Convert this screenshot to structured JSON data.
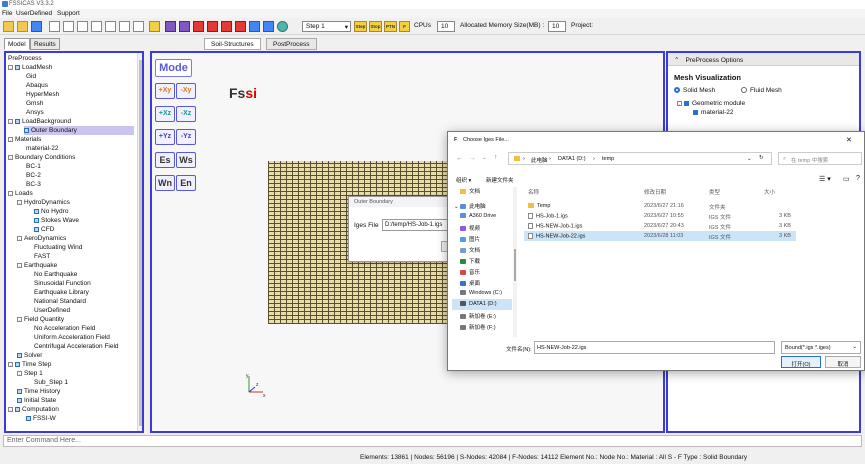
{
  "app": {
    "title": "FSSICAS V3.3.2"
  },
  "menu": [
    "File",
    "UserDefined",
    "Support"
  ],
  "toolbar": {
    "step_value": "Step 1",
    "btn_step": "Step",
    "btn_stop": "Stop",
    "btn_ptn": "PTN",
    "btn_fortran": "F",
    "cpus_label": "CPUs",
    "cpus_value": "10",
    "memory_label": "Allocated Memory Size(MB) :",
    "memory_value": "10",
    "project_label": "Project:"
  },
  "left_tabs": [
    "Model",
    "Results"
  ],
  "tree": [
    "PreProcess",
    "LoadMesh",
    "Gid",
    "Abaqus",
    "HyperMesh",
    "Gmsh",
    "Ansys",
    "LoadBackground",
    "Outer Boundary",
    "Materials",
    "material-22",
    "Boundary Conditions",
    "BC-1",
    "BC-2",
    "BC-3",
    "Loads",
    "HydroDynamics",
    "No Hydro",
    "Stokes Wave",
    "CFD",
    "AeroDynamics",
    "Fluctuating Wind",
    "FAST",
    "Earthquake",
    "No Earthquake",
    "Sinusoidal Function",
    "Earthquake Library",
    "National Standard",
    "UserDefined",
    "Field Quantity",
    "No Acceleration Field",
    "Uniform Acceleration Field",
    "Centrifugal Acceleration Field",
    "Solver",
    "Time Step",
    "Step 1",
    "Sub_Step 1",
    "Time History",
    "Initial State",
    "Computation",
    "FSSI-W"
  ],
  "view_tabs": [
    "Soil-Structures",
    "PostProcess"
  ],
  "view_buttons": [
    "Mode",
    "+Xy",
    "-Xy",
    "+Xz",
    "-Xz",
    "+Yz",
    "-Yz",
    "Es",
    "Ws",
    "Wn",
    "En"
  ],
  "logo": {
    "main": "Fs",
    "sub": "si"
  },
  "axes": {
    "x": "x",
    "y": "y",
    "z": "z"
  },
  "outer_dialog": {
    "title": "Outer Boundary",
    "iges_label": "Iges File",
    "iges_value": "D:/temp/HS-Job-1.igs"
  },
  "preprocess_options": {
    "title": "PreProcess Options",
    "section": "Mesh Visualization",
    "solid": "Solid Mesh",
    "fluid": "Fluid Mesh",
    "geom": "Geometric module",
    "material": "material-22"
  },
  "file_dialog": {
    "title": "Choose Iges File...",
    "path": [
      "此电脑",
      "DATA1 (D:)",
      "temp"
    ],
    "search_placeholder": "在 temp 中搜索",
    "organize": "组织 ▾",
    "new_folder": "新建文件夹",
    "columns": [
      "名称",
      "修改日期",
      "类型",
      "大小"
    ],
    "files": [
      {
        "name": "Temp",
        "date": "2023/6/27 21:16",
        "type": "文件夹",
        "size": ""
      },
      {
        "name": "HS-Job-1.igs",
        "date": "2023/6/27 10:55",
        "type": "IGS 文件",
        "size": "3 KB"
      },
      {
        "name": "HS-NEW-Job-1.igs",
        "date": "2023/6/27 20:43",
        "type": "IGS 文件",
        "size": "3 KB"
      },
      {
        "name": "HS-NEW-Job-22.igs",
        "date": "2023/6/28 11:03",
        "type": "IGS 文件",
        "size": "3 KB"
      }
    ],
    "sidebar": [
      "文档",
      "此电脑",
      "A360 Drive",
      "视频",
      "图片",
      "文档",
      "下载",
      "音乐",
      "桌面",
      "Windows (C:)",
      "DATA1 (D:)",
      "新加卷 (E:)",
      "新加卷 (F:)"
    ],
    "filename_label": "文件名(N):",
    "filename_value": "HS-NEW-Job-22.igs",
    "filter": "Bound(*.igs *.iges)",
    "open_btn": "打开(O)",
    "cancel_btn": "取消"
  },
  "command": {
    "placeholder": "Enter Command Here..."
  },
  "status": "Elements: 13861 | Nodes: 56196 | S-Nodes: 42084 | F-Nodes: 14112 Element No.: Node No.: Material : All S - F Type : Solid Boundary",
  "colors": {
    "accent": "#3b3bd9",
    "mesh": "#e8dcaa",
    "selection": "#cce4f7"
  }
}
